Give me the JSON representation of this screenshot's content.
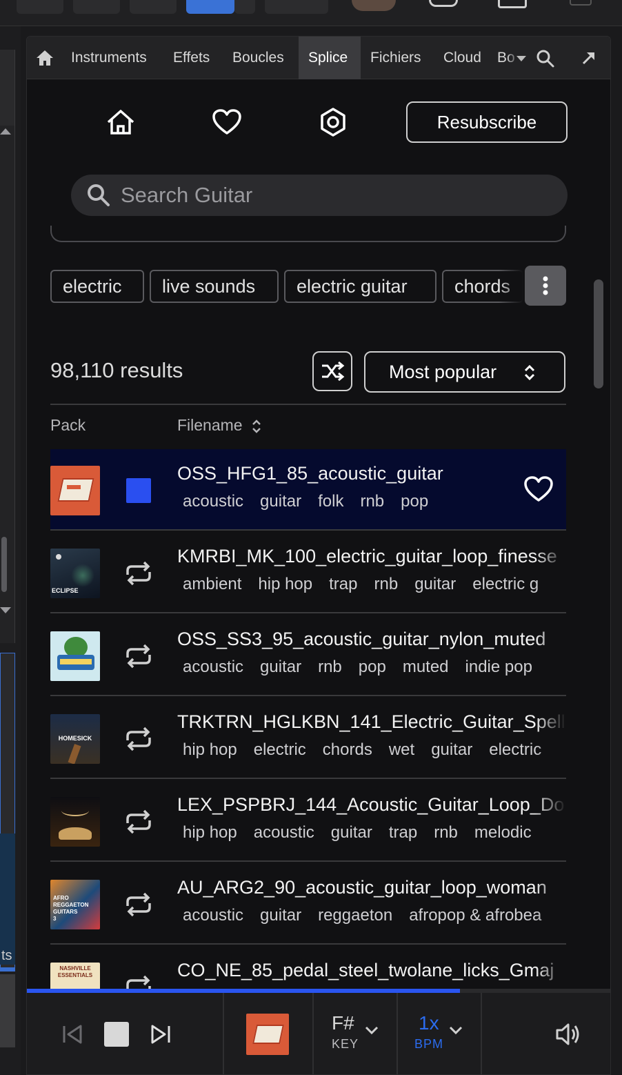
{
  "tabs": [
    {
      "label": "Instruments"
    },
    {
      "label": "Effets"
    },
    {
      "label": "Boucles"
    },
    {
      "label": "Splice",
      "active": true
    },
    {
      "label": "Fichiers"
    },
    {
      "label": "Cloud"
    },
    {
      "label": "Bo"
    }
  ],
  "header": {
    "resubscribe_label": "Resubscribe"
  },
  "search": {
    "placeholder": "Search Guitar"
  },
  "filter_tags": [
    "electric",
    "live sounds",
    "electric guitar",
    "chords"
  ],
  "results": {
    "count": "98,110 results",
    "sort_label": "Most popular"
  },
  "columns": {
    "pack": "Pack",
    "filename": "Filename"
  },
  "rows": [
    {
      "filename": "OSS_HFG1_85_acoustic_guitar",
      "tags": [
        "acoustic",
        "guitar",
        "folk",
        "rnb",
        "pop"
      ],
      "selected": true
    },
    {
      "filename": "KMRBI_MK_100_electric_guitar_loop_finesse",
      "tags": [
        "ambient",
        "hip hop",
        "trap",
        "rnb",
        "guitar",
        "electric g"
      ]
    },
    {
      "filename": "OSS_SS3_95_acoustic_guitar_nylon_muted",
      "tags": [
        "acoustic",
        "guitar",
        "rnb",
        "pop",
        "muted",
        "indie pop"
      ]
    },
    {
      "filename": "TRKTRN_HGLKBN_141_Electric_Guitar_Spell",
      "tags": [
        "hip hop",
        "electric",
        "chords",
        "wet",
        "guitar",
        "electric"
      ]
    },
    {
      "filename": "LEX_PSPBRJ_144_Acoustic_Guitar_Loop_Do",
      "tags": [
        "hip hop",
        "acoustic",
        "guitar",
        "trap",
        "rnb",
        "melodic"
      ]
    },
    {
      "filename": "AU_ARG2_90_acoustic_guitar_loop_woman",
      "tags": [
        "acoustic",
        "guitar",
        "reggaeton",
        "afropop & afrobea"
      ]
    },
    {
      "filename": "CO_NE_85_pedal_steel_twolane_licks_Gmaj",
      "tags": []
    }
  ],
  "thumb_text": {
    "eclipse": "ECLIPSE",
    "homesick": "HOMESICK",
    "afro": "AFRO REGGAETON GUITARS 3",
    "nashville": "NASHVILLE ESSENTIALS"
  },
  "player": {
    "progress": 0.74,
    "key_value": "F#",
    "key_label": "KEY",
    "bpm_value": "1x",
    "bpm_label": "BPM"
  },
  "host_left_label": "ts",
  "colors": {
    "accent": "#2a55f0",
    "selected_row": "#050a2e",
    "panel_bg": "#111113"
  }
}
